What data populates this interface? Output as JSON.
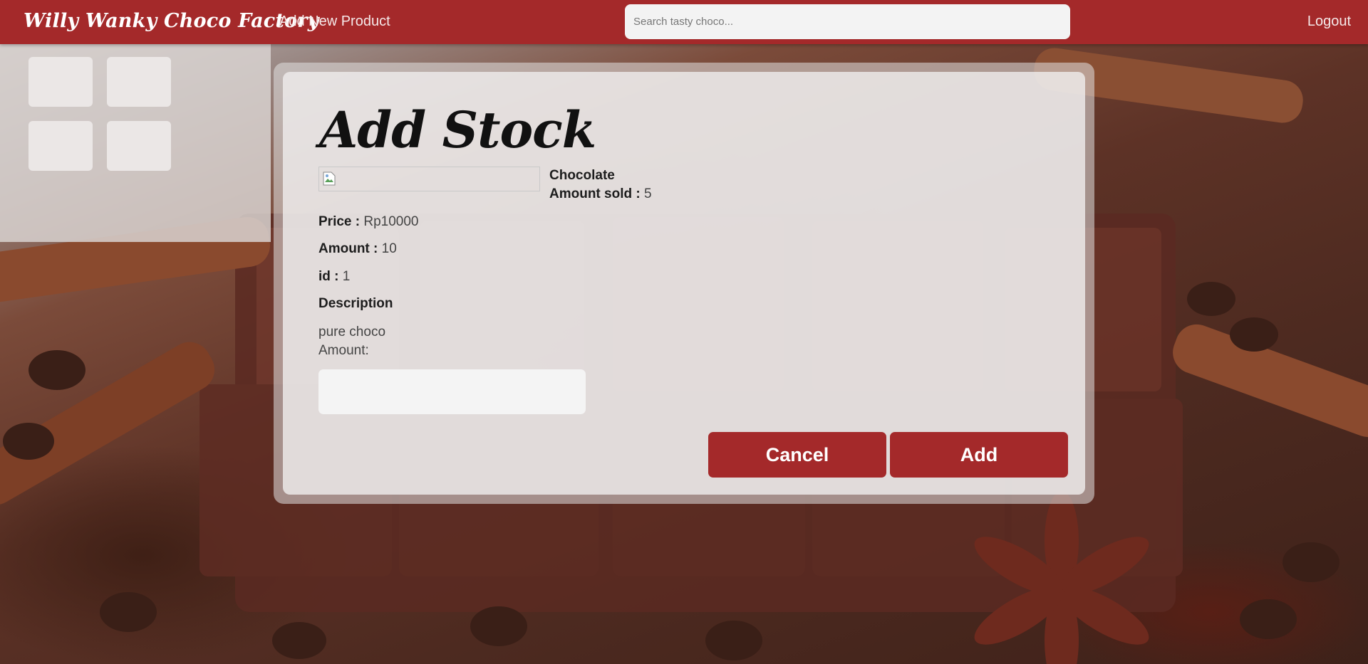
{
  "navbar": {
    "brand": "Willy Wanky Choco Factory",
    "add_product_link": "Add New Product",
    "search_placeholder": "Search tasty choco...",
    "logout_link": "Logout"
  },
  "form": {
    "title": "Add Stock",
    "product_name": "Chocolate",
    "amount_sold_label": "Amount sold :",
    "amount_sold_value": "5",
    "price_label": "Price :",
    "price_value": "Rp10000",
    "amount_label": "Amount :",
    "amount_value": "10",
    "id_label": "id :",
    "id_value": "1",
    "description_label": "Description",
    "description_value": "pure choco",
    "amount_input_label": "Amount:",
    "amount_input_value": "",
    "cancel_label": "Cancel",
    "add_label": "Add"
  },
  "colors": {
    "primary": "#a4292a",
    "card": "#eeecec"
  }
}
